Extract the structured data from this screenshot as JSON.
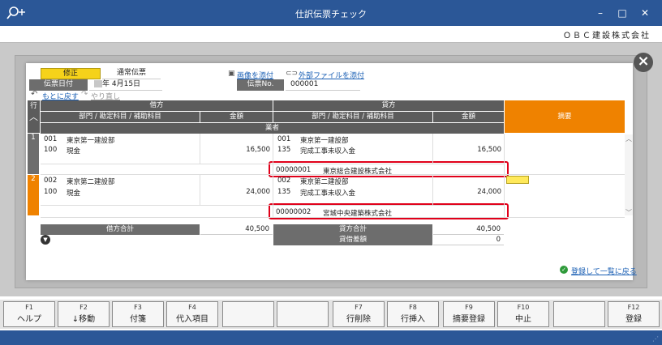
{
  "window": {
    "title": "仕訳伝票チェック",
    "company": "ＯＢＣ建設株式会社"
  },
  "form": {
    "mode": "修正",
    "voucher_type": "通常伝票",
    "date_label": "伝票日付",
    "date_value": "年  4月15日",
    "attach_image": "画像を添付",
    "attach_file": "外部ファイルを添付",
    "voucher_no_label": "伝票No.",
    "voucher_no": "000001",
    "undo": "もとに戻す",
    "redo": "やり直し"
  },
  "grid": {
    "row_header": "行",
    "debit_title": "借方",
    "credit_title": "貸方",
    "dept_account_header": "部門 / 勘定科目 / 補助科目",
    "amount_header": "金額",
    "vendor_header": "業者",
    "summary_header": "摘要",
    "rows": [
      {
        "num": "1",
        "debit_dept_code": "001",
        "debit_dept": "東京第一建設部",
        "debit_acct_code": "100",
        "debit_acct": "現金",
        "debit_amount": "16,500",
        "credit_dept_code": "001",
        "credit_dept": "東京第一建設部",
        "credit_acct_code": "135",
        "credit_acct": "完成工事未収入金",
        "credit_amount": "16,500",
        "vendor_code": "00000001",
        "vendor_name": "東京総合建設株式会社"
      },
      {
        "num": "2",
        "debit_dept_code": "002",
        "debit_dept": "東京第二建設部",
        "debit_acct_code": "100",
        "debit_acct": "現金",
        "debit_amount": "24,000",
        "credit_dept_code": "002",
        "credit_dept": "東京第二建設部",
        "credit_acct_code": "135",
        "credit_acct": "完成工事未収入金",
        "credit_amount": "24,000",
        "vendor_code": "00000002",
        "vendor_name": "宮城中央建築株式会社"
      }
    ]
  },
  "totals": {
    "debit_label": "借方合計",
    "debit_value": "40,500",
    "credit_label": "貸方合計",
    "credit_value": "40,500",
    "diff_label": "貸借差額",
    "diff_value": "0"
  },
  "return_link": "登録して一覧に戻る",
  "fkeys": [
    {
      "key": "F1",
      "label": "ヘルプ"
    },
    {
      "key": "F2",
      "label": "↓移動"
    },
    {
      "key": "F3",
      "label": "付箋"
    },
    {
      "key": "F4",
      "label": "代入項目"
    },
    {
      "key": "",
      "label": ""
    },
    {
      "key": "",
      "label": ""
    },
    {
      "key": "F7",
      "label": "行削除"
    },
    {
      "key": "F8",
      "label": "行挿入"
    },
    {
      "key": "F9",
      "label": "摘要登録"
    },
    {
      "key": "F10",
      "label": "中止"
    },
    {
      "key": "",
      "label": ""
    },
    {
      "key": "F12",
      "label": "登録"
    }
  ],
  "colors": {
    "titlebar": "#2b5797",
    "accent_orange": "#ef8200",
    "highlight_red": "#e0001a",
    "mode_yellow": "#f5d21a"
  }
}
